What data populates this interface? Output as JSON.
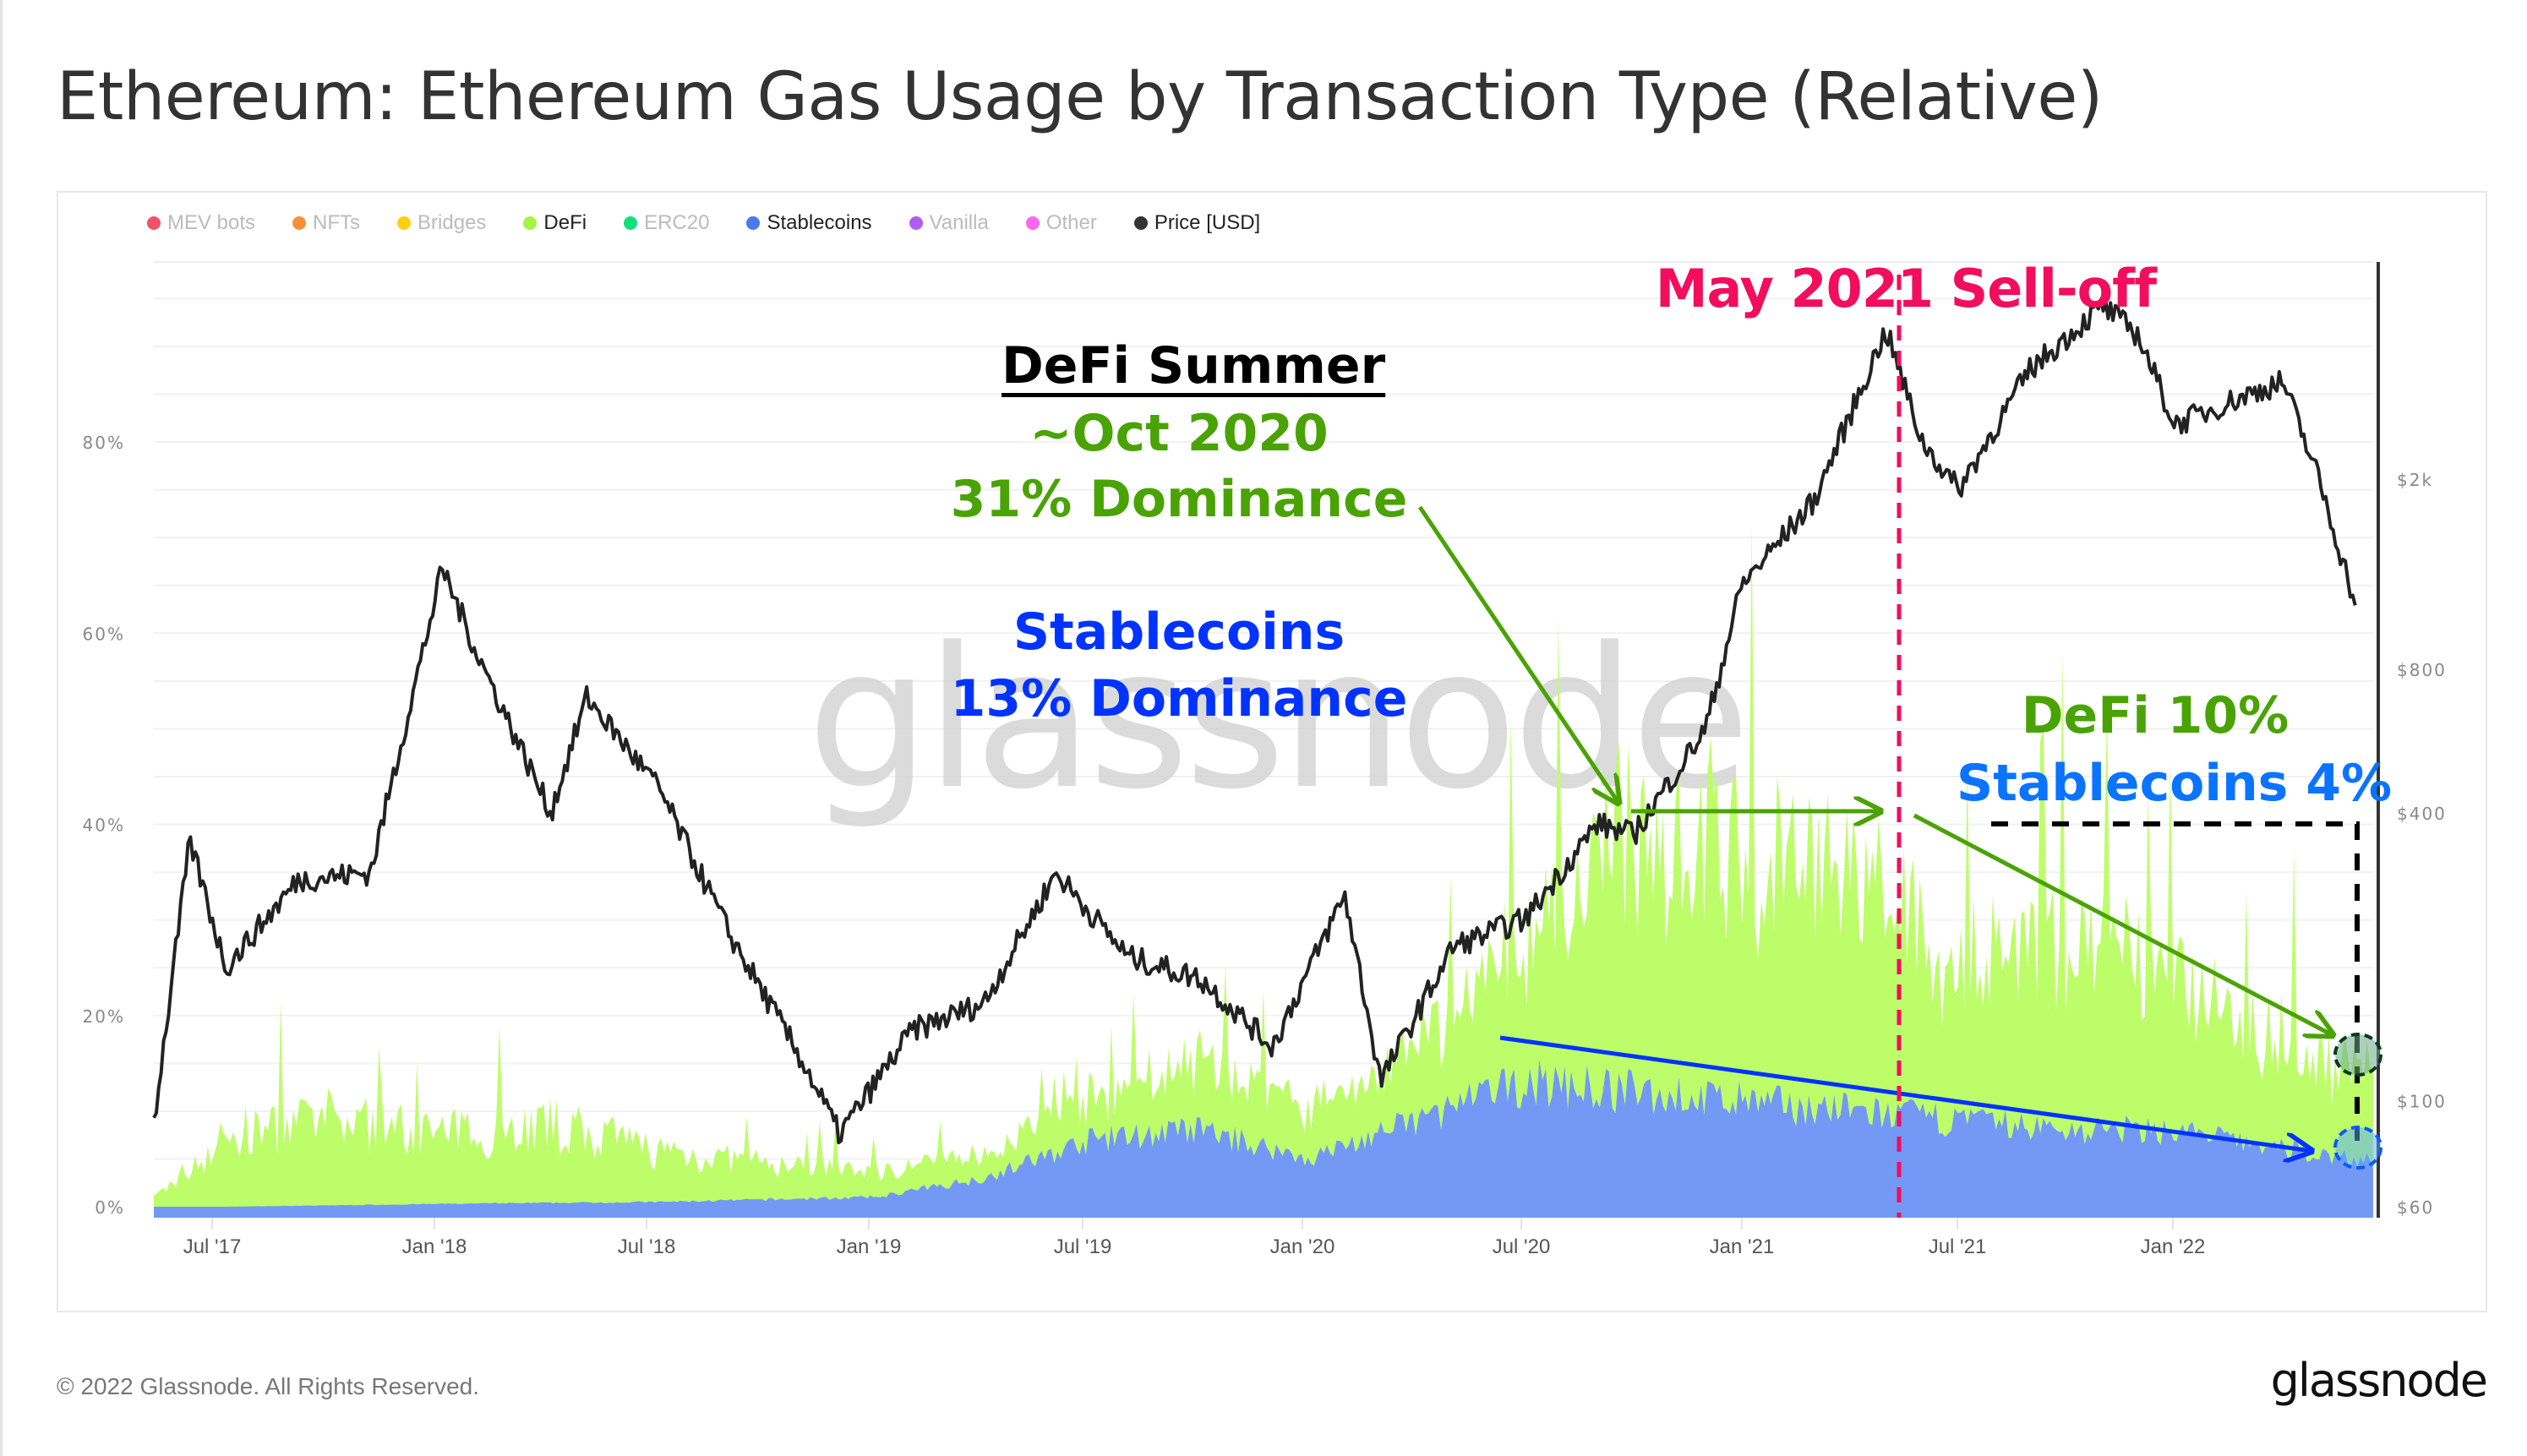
{
  "title": "Ethereum: Ethereum Gas Usage by Transaction Type (Relative)",
  "footer": "© 2022 Glassnode. All Rights Reserved.",
  "brand": "glassnode",
  "watermark": "glassnode",
  "legend": [
    {
      "label": "MEV bots",
      "color": "#f25267",
      "active": false
    },
    {
      "label": "NFTs",
      "color": "#f7903b",
      "active": false
    },
    {
      "label": "Bridges",
      "color": "#fcd012",
      "active": false
    },
    {
      "label": "DeFi",
      "color": "#a3f543",
      "active": true
    },
    {
      "label": "ERC20",
      "color": "#0ee07c",
      "active": false
    },
    {
      "label": "Stablecoins",
      "color": "#4a78f0",
      "active": true
    },
    {
      "label": "Vanilla",
      "color": "#b05cf0",
      "active": false
    },
    {
      "label": "Other",
      "color": "#fb67ee",
      "active": false
    },
    {
      "label": "Price [USD]",
      "color": "#333333",
      "active": true
    }
  ],
  "annotations": {
    "defi_summer": "DeFi Summer",
    "oct_2020": "~Oct 2020",
    "defi_dom": "31% Dominance",
    "stable_title": "Stablecoins",
    "stable_dom": "13% Dominance",
    "may_selloff": "May 2021 Sell-off",
    "defi_now": "DeFi 10%",
    "stable_now": "Stablecoins 4%"
  },
  "colors": {
    "defi_fill": "#bdfd6a",
    "stable_fill": "#7399f5",
    "price_line": "#222222",
    "selloff": "#f20d5d",
    "defi_text": "#4aa304",
    "stable_text": "#0033ff",
    "stable_now_text": "#0a74ff"
  },
  "chart_data": {
    "type": "area",
    "title": "Ethereum: Ethereum Gas Usage by Transaction Type (Relative)",
    "x_ticks": [
      "Jul '17",
      "Jan '18",
      "Jul '18",
      "Jan '19",
      "Jul '19",
      "Jan '20",
      "Jul '20",
      "Jan '21",
      "Jul '21",
      "Jan '22"
    ],
    "y_left": {
      "ticks": [
        "0%",
        "20%",
        "40%",
        "60%",
        "80%"
      ],
      "range": [
        0,
        80
      ]
    },
    "y_right": {
      "ticks": [
        "$60",
        "$100",
        "$400",
        "$800",
        "$2k"
      ],
      "scale": "log",
      "range": [
        60,
        4500
      ]
    },
    "x_range": [
      "2017-05",
      "2022-06"
    ],
    "legend_position": "top-left",
    "grid": true,
    "series": [
      {
        "name": "Stablecoins",
        "type": "stacked-area",
        "x": [
          "2017-05",
          "2017-07",
          "2018-01",
          "2018-07",
          "2019-01",
          "2019-04",
          "2019-07",
          "2019-10",
          "2020-01",
          "2020-04",
          "2020-07",
          "2020-10",
          "2021-01",
          "2021-04",
          "2021-07",
          "2021-10",
          "2022-01",
          "2022-04",
          "2022-06"
        ],
        "values": [
          0,
          0,
          0.3,
          0.5,
          1,
          3,
          7,
          8,
          5,
          9,
          13,
          12,
          11,
          10,
          9,
          8,
          8,
          6,
          5
        ]
      },
      {
        "name": "DeFi",
        "type": "stacked-area",
        "x": [
          "2017-05",
          "2017-07",
          "2017-10",
          "2018-01",
          "2018-04",
          "2018-07",
          "2018-10",
          "2019-01",
          "2019-04",
          "2019-07",
          "2019-10",
          "2020-01",
          "2020-04",
          "2020-07",
          "2020-10",
          "2021-01",
          "2021-04",
          "2021-07",
          "2021-10",
          "2022-01",
          "2022-04",
          "2022-06"
        ],
        "values": [
          1,
          8,
          10,
          8,
          9,
          6,
          4,
          3,
          3,
          5,
          8,
          6,
          8,
          17,
          31,
          29,
          27,
          18,
          22,
          17,
          13,
          10
        ]
      },
      {
        "name": "Price [USD]",
        "type": "line",
        "axis": "right",
        "x": [
          "2017-05",
          "2017-06",
          "2017-07",
          "2017-09",
          "2017-11",
          "2018-01",
          "2018-02",
          "2018-04",
          "2018-05",
          "2018-07",
          "2018-09",
          "2018-11",
          "2018-12",
          "2019-02",
          "2019-04",
          "2019-06",
          "2019-08",
          "2019-10",
          "2019-12",
          "2020-02",
          "2020-03",
          "2020-05",
          "2020-07",
          "2020-09",
          "2020-10",
          "2020-12",
          "2021-01",
          "2021-03",
          "2021-05",
          "2021-06",
          "2021-07",
          "2021-09",
          "2021-11",
          "2021-12",
          "2022-01",
          "2022-03",
          "2022-04",
          "2022-05",
          "2022-06"
        ],
        "values": [
          90,
          350,
          190,
          290,
          300,
          1300,
          850,
          400,
          700,
          450,
          220,
          120,
          85,
          140,
          160,
          300,
          200,
          180,
          130,
          270,
          110,
          210,
          240,
          380,
          360,
          600,
          1200,
          1800,
          4100,
          2400,
          1900,
          3400,
          4600,
          4000,
          2600,
          3000,
          3200,
          2000,
          1100
        ]
      }
    ],
    "annotations": [
      {
        "text": "DeFi Summer ~Oct 2020 31% Dominance"
      },
      {
        "text": "Stablecoins 13% Dominance"
      },
      {
        "text": "May 2021 Sell-off",
        "x": "2021-05"
      },
      {
        "text": "DeFi 10% Stablecoins 4%",
        "x": "2022-06"
      }
    ]
  }
}
